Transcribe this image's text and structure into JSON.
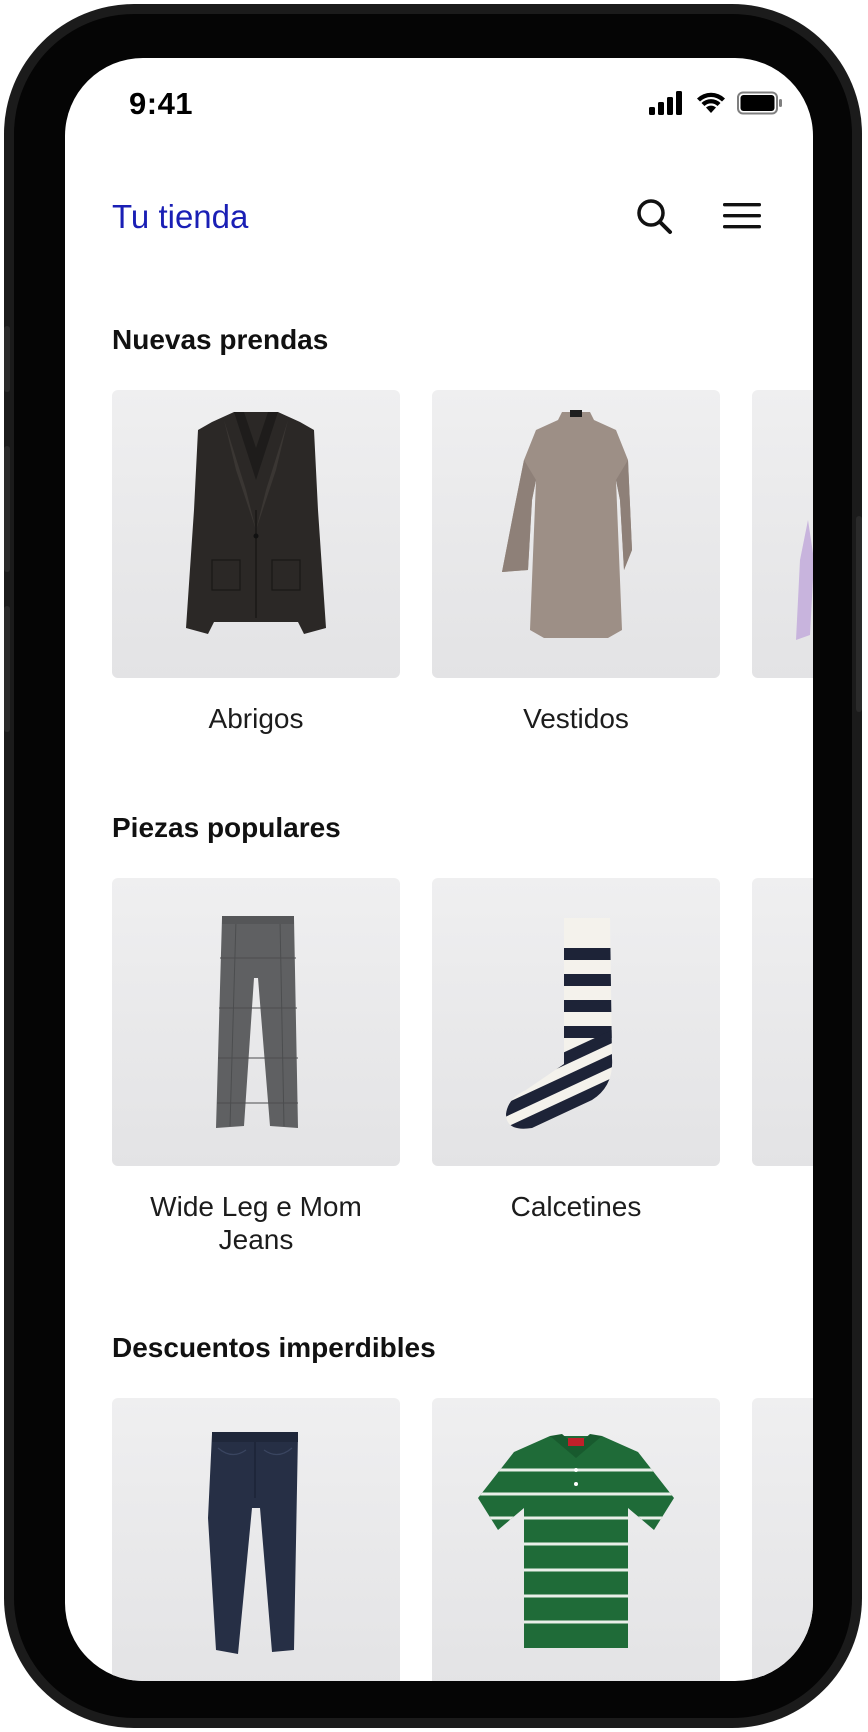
{
  "status_bar": {
    "time": "9:41",
    "icons": [
      "cellular-signal-icon",
      "wifi-icon",
      "battery-icon"
    ]
  },
  "header": {
    "brand": "Tu tienda",
    "search_icon": "search-icon",
    "menu_icon": "hamburger-menu-icon",
    "brand_color": "#1a1fb5"
  },
  "sections": [
    {
      "title": "Nuevas prendas",
      "items": [
        {
          "label": "Abrigos",
          "image": "black-blazer"
        },
        {
          "label": "Vestidos",
          "image": "taupe-knit-dress"
        },
        {
          "label": "",
          "image": "lilac-garment-partial"
        }
      ]
    },
    {
      "title": "Piezas populares",
      "items": [
        {
          "label": "Wide Leg e Mom Jeans",
          "image": "grey-check-trousers"
        },
        {
          "label": "Calcetines",
          "image": "striped-sock"
        },
        {
          "label": "",
          "image": "partial-card"
        }
      ]
    },
    {
      "title": "Descuentos imperdibles",
      "items": [
        {
          "label": "",
          "image": "dark-denim-jeans"
        },
        {
          "label": "",
          "image": "green-striped-polo"
        },
        {
          "label": "",
          "image": "partial-card"
        }
      ]
    }
  ]
}
